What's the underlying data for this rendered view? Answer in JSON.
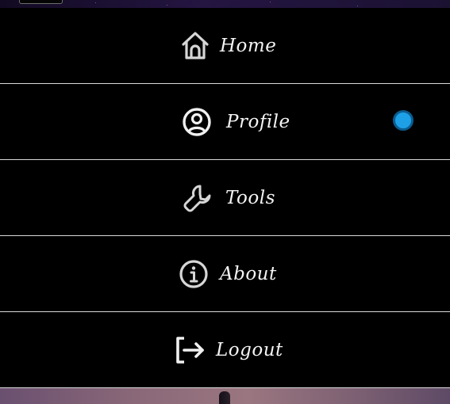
{
  "menu": {
    "items": [
      {
        "label": "Home",
        "icon": "home-icon"
      },
      {
        "label": "Profile",
        "icon": "user-circle-icon"
      },
      {
        "label": "Tools",
        "icon": "wrench-icon"
      },
      {
        "label": "About",
        "icon": "info-icon"
      },
      {
        "label": "Logout",
        "icon": "logout-icon"
      }
    ]
  },
  "colors": {
    "background": "#000000",
    "divider": "#d9d9d9",
    "text": "#f4f4f4",
    "status_dot": "#1ea0e6"
  }
}
